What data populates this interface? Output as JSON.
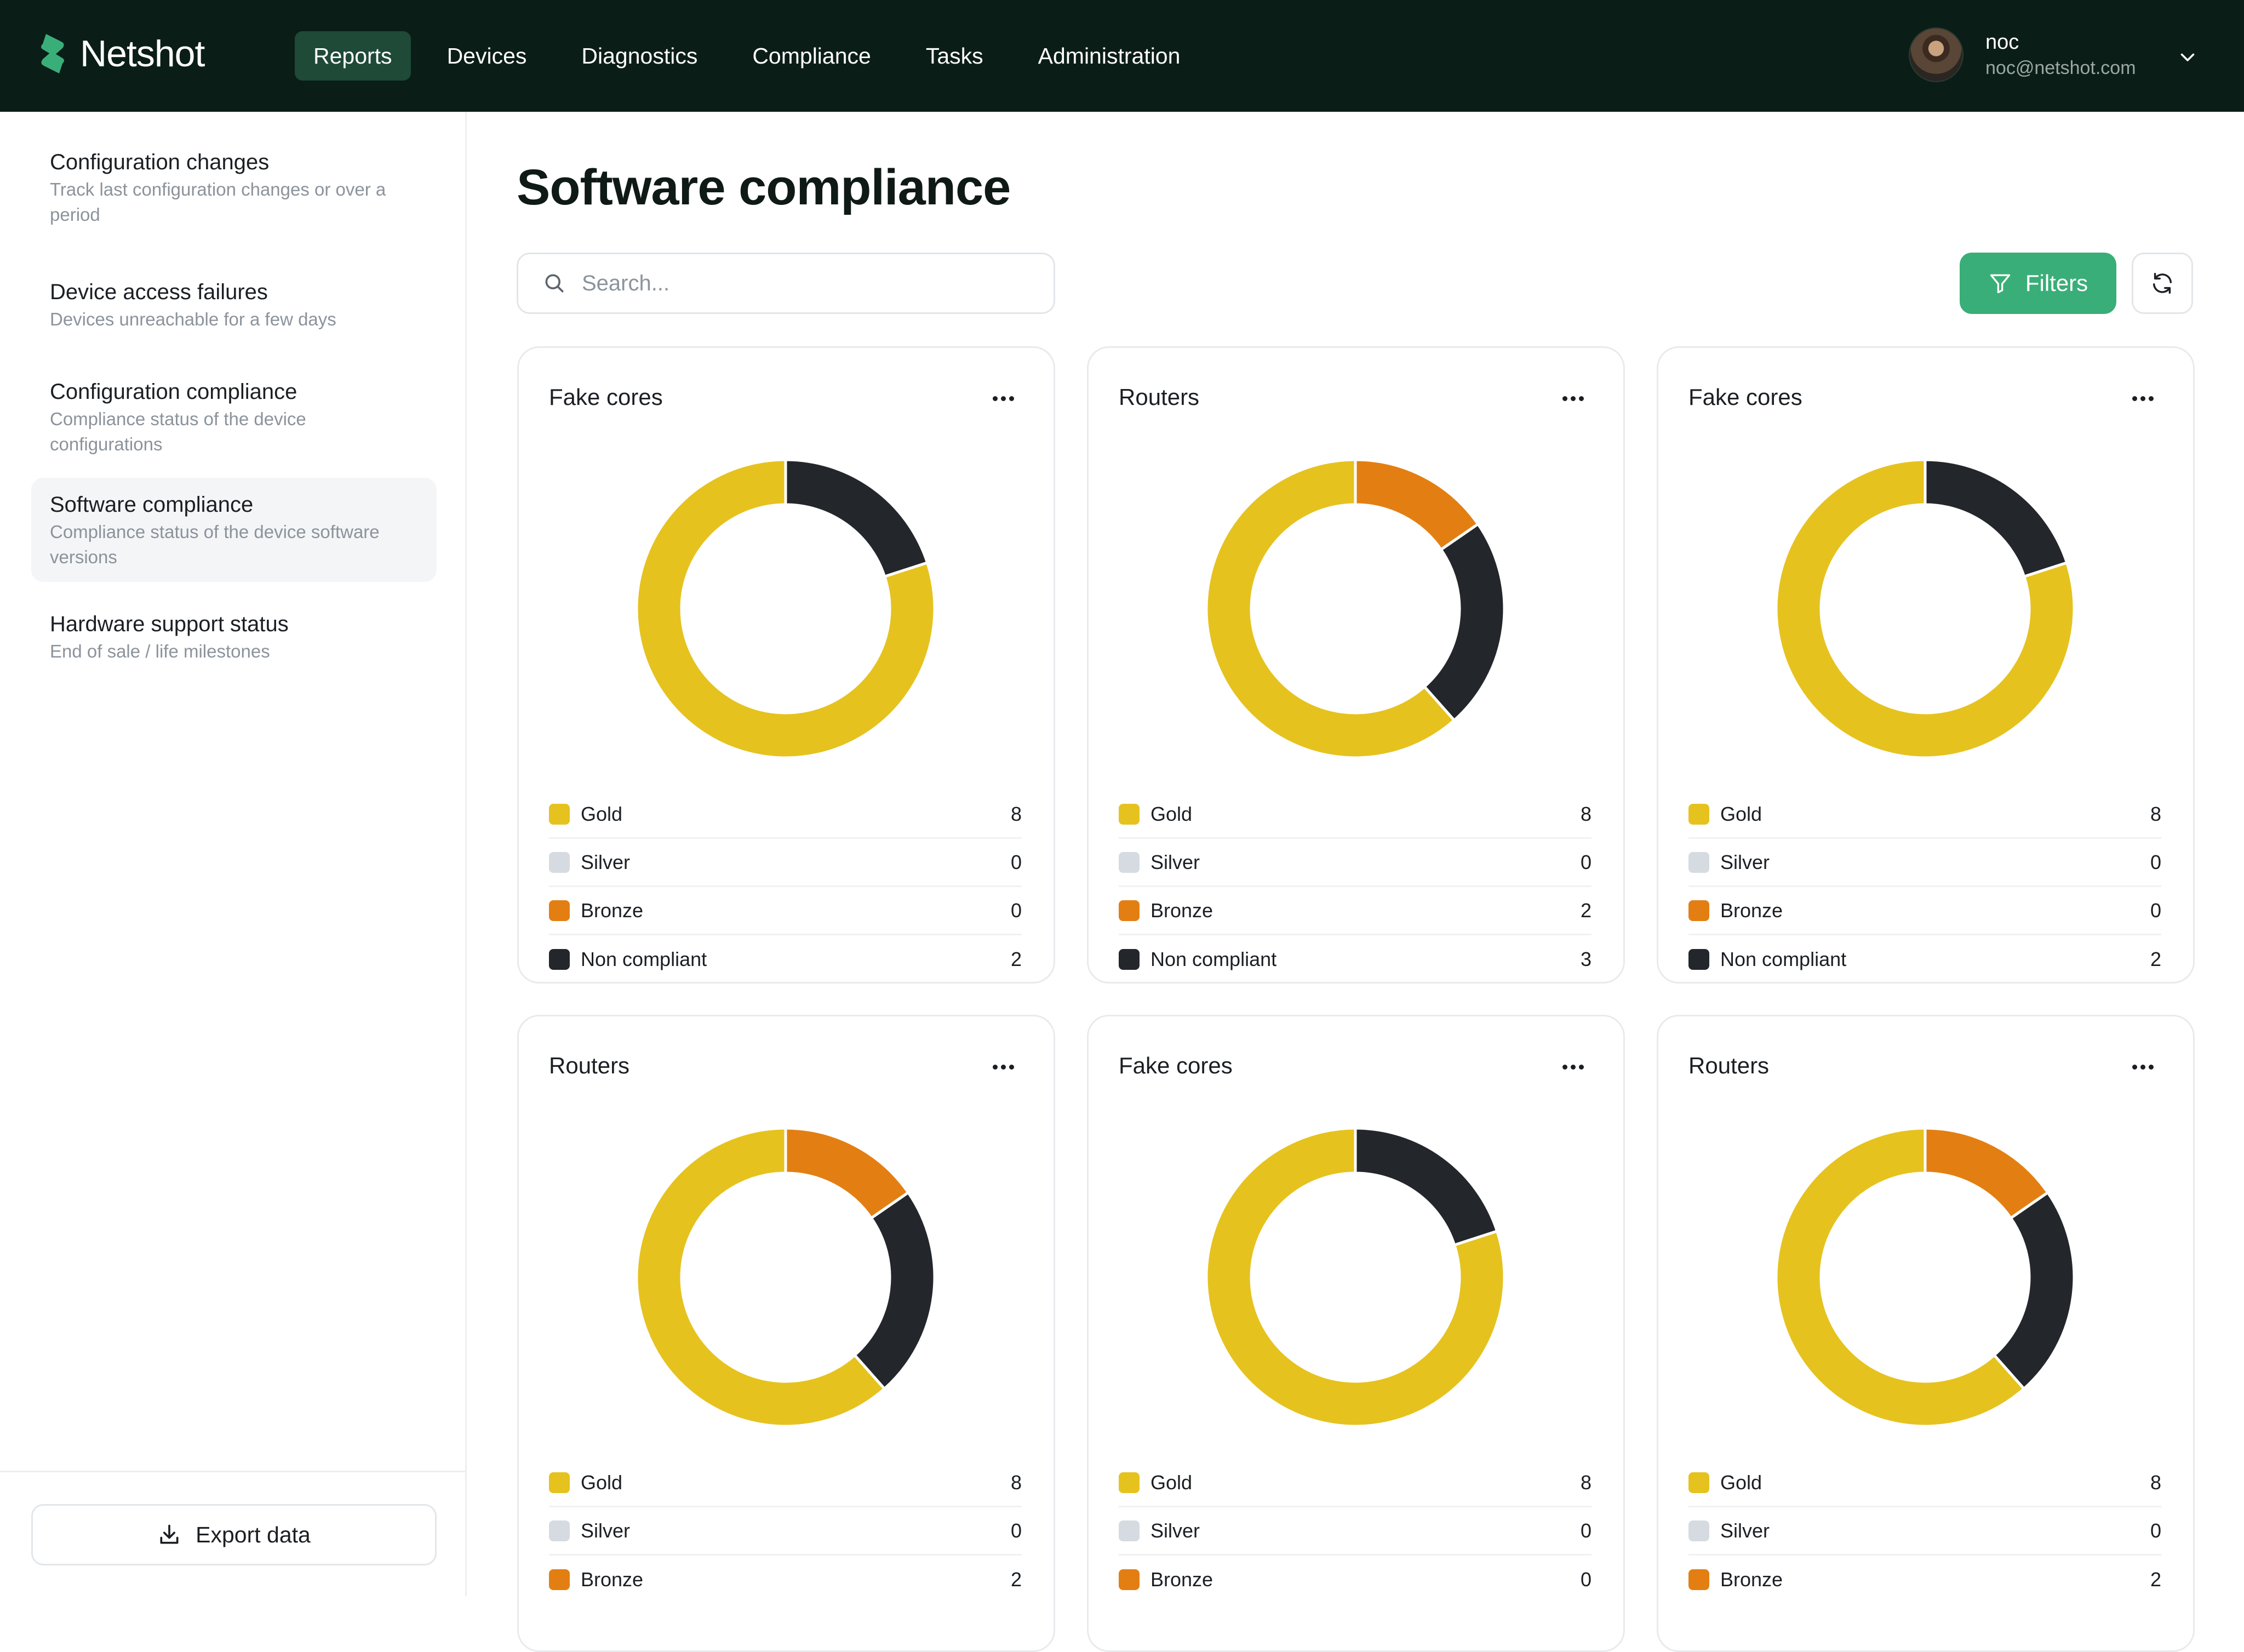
{
  "app": {
    "name": "Netshot"
  },
  "nav": {
    "items": [
      {
        "label": "Reports",
        "active": true
      },
      {
        "label": "Devices",
        "active": false
      },
      {
        "label": "Diagnostics",
        "active": false
      },
      {
        "label": "Compliance",
        "active": false
      },
      {
        "label": "Tasks",
        "active": false
      },
      {
        "label": "Administration",
        "active": false
      }
    ]
  },
  "user": {
    "name": "noc",
    "email": "noc@netshot.com"
  },
  "sidebar": {
    "items": [
      {
        "title": "Configuration changes",
        "desc": "Track last configuration changes or over a period"
      },
      {
        "title": "Device access failures",
        "desc": "Devices unreachable for a few days"
      },
      {
        "title": "Configuration compliance",
        "desc": "Compliance status of the device configurations"
      },
      {
        "title": "Software compliance",
        "desc": "Compliance status of the device software versions",
        "active": true
      },
      {
        "title": "Hardware support status",
        "desc": "End of sale / life milestones"
      }
    ],
    "export_label": "Export data"
  },
  "page": {
    "title": "Software compliance",
    "search_placeholder": "Search...",
    "filters_label": "Filters"
  },
  "colors": {
    "gold": "#e6c21e",
    "silver": "#d5dbe0",
    "bronze": "#e37f12",
    "non_compliant": "#23262b",
    "accent": "#3aae78",
    "topbar": "#0b1d17"
  },
  "chart_data": [
    {
      "type": "pie",
      "title": "Fake cores",
      "categories": [
        "Gold",
        "Silver",
        "Bronze",
        "Non compliant"
      ],
      "values": [
        8,
        0,
        0,
        2
      ]
    },
    {
      "type": "pie",
      "title": "Routers",
      "categories": [
        "Gold",
        "Silver",
        "Bronze",
        "Non compliant"
      ],
      "values": [
        8,
        0,
        2,
        3
      ]
    },
    {
      "type": "pie",
      "title": "Fake cores",
      "categories": [
        "Gold",
        "Silver",
        "Bronze",
        "Non compliant"
      ],
      "values": [
        8,
        0,
        0,
        2
      ]
    },
    {
      "type": "pie",
      "title": "Routers",
      "categories": [
        "Gold",
        "Silver",
        "Bronze"
      ],
      "values": [
        8,
        0,
        2
      ]
    },
    {
      "type": "pie",
      "title": "Fake cores",
      "categories": [
        "Gold",
        "Silver",
        "Bronze"
      ],
      "values": [
        8,
        0,
        0
      ]
    },
    {
      "type": "pie",
      "title": "Routers",
      "categories": [
        "Gold",
        "Silver",
        "Bronze"
      ],
      "values": [
        8,
        0,
        2
      ]
    }
  ]
}
